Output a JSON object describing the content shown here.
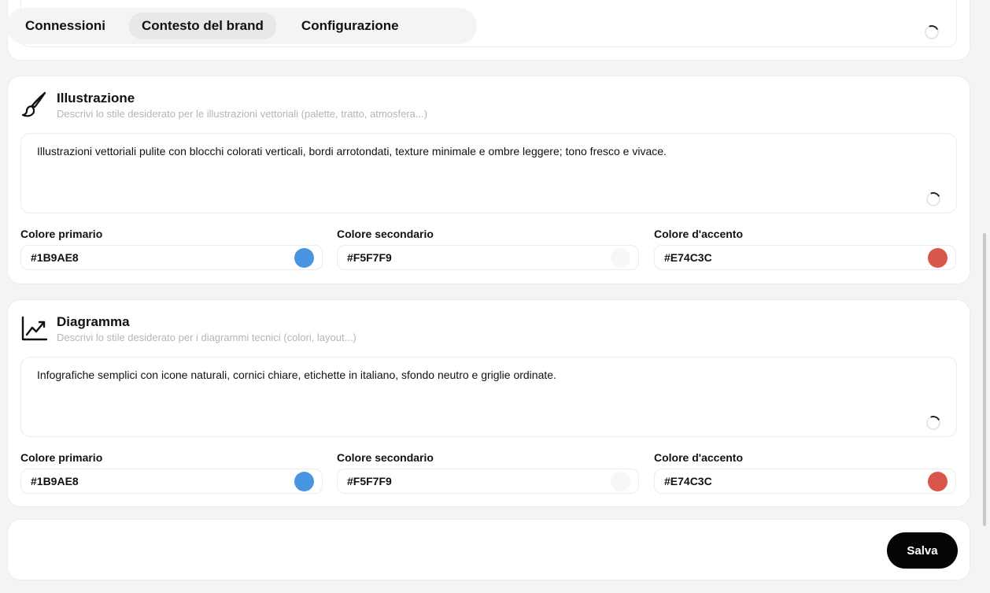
{
  "tabs": [
    {
      "label": "Connessioni"
    },
    {
      "label": "Contesto del brand"
    },
    {
      "label": "Configurazione"
    }
  ],
  "active_tab": "Contesto del brand",
  "illustration": {
    "title": "Illustrazione",
    "subtitle": "Descrivi lo stile desiderato per le illustrazioni vettoriali (palette, tratto, atmosfera...)",
    "description": "Illustrazioni vettoriali pulite con blocchi colorati verticali, bordi arrotondati, texture minimale e ombre leggere; tono fresco e vivace.",
    "icon": "brush-icon",
    "colors": {
      "primary_label": "Colore primario",
      "primary_value": "#1B9AE8",
      "primary_swatch": "#4a95e0",
      "secondary_label": "Colore secondario",
      "secondary_value": "#F5F7F9",
      "secondary_swatch": "#f5f7f9",
      "accent_label": "Colore d'accento",
      "accent_value": "#E74C3C",
      "accent_swatch": "#d9574a"
    }
  },
  "diagram": {
    "title": "Diagramma",
    "subtitle": "Descrivi lo stile desiderato per i diagrammi tecnici (colori, layout...)",
    "description": "Infografiche semplici con icone naturali, cornici chiare, etichette in italiano, sfondo neutro e griglie ordinate.",
    "icon": "trending-up-chart-icon",
    "colors": {
      "primary_label": "Colore primario",
      "primary_value": "#1B9AE8",
      "primary_swatch": "#4a95e0",
      "secondary_label": "Colore secondario",
      "secondary_value": "#F5F7F9",
      "secondary_swatch": "#f5f7f9",
      "accent_label": "Colore d'accento",
      "accent_value": "#E74C3C",
      "accent_swatch": "#d9574a"
    }
  },
  "save_label": "Salva"
}
